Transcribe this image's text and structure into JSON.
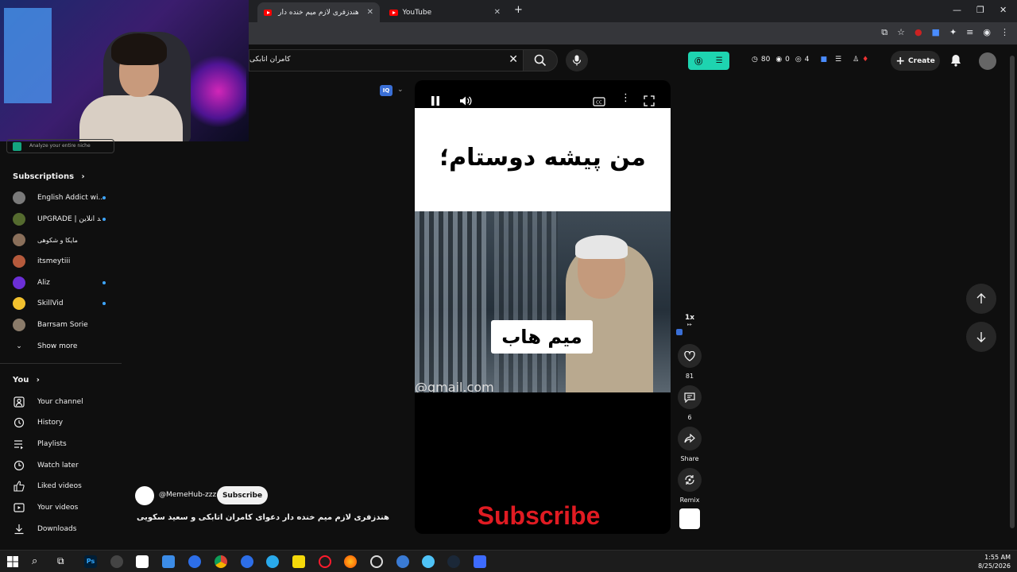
{
  "browser": {
    "tabs": [
      {
        "title": "هندزفری لازم میم خنده دار د...",
        "active": true
      },
      {
        "title": "YouTube",
        "active": false
      }
    ],
    "new_tab": "+",
    "minimize": "—",
    "restore": "❐",
    "close": "✕"
  },
  "header": {
    "search_value": "کامران اتابکی",
    "ext_stats": {
      "views": "80",
      "likes": "0",
      "watch": "4"
    },
    "create_label": "Create"
  },
  "sidebar": {
    "promo_text": "Analyze your entire niche",
    "subscriptions_heading": "Subscriptions",
    "subscriptions": [
      {
        "label": "English Addict wi...",
        "color": "#7a7a7a",
        "dot": true
      },
      {
        "label": "UPGRADE | ارتقا بد آنلاین",
        "color": "#556b2f",
        "dot": true
      },
      {
        "label": "مایکا و شکوهی",
        "color": "#8a6f5a",
        "dot": false
      },
      {
        "label": "itsmeytiii",
        "color": "#b55a3c",
        "dot": false
      },
      {
        "label": "Aliz",
        "color": "#6b2fd6",
        "dot": true
      },
      {
        "label": "SkillVid",
        "color": "#f2c12e",
        "dot": true
      },
      {
        "label": "Barrsam Sorie",
        "color": "#8a7b6a",
        "dot": false
      }
    ],
    "show_more": "Show more",
    "you_heading": "You",
    "you_items": [
      {
        "label": "Your channel",
        "icon": "person-icon"
      },
      {
        "label": "History",
        "icon": "history-icon"
      },
      {
        "label": "Playlists",
        "icon": "playlists-icon"
      },
      {
        "label": "Watch later",
        "icon": "clock-icon"
      },
      {
        "label": "Liked videos",
        "icon": "thumbs-up-icon"
      },
      {
        "label": "Your videos",
        "icon": "video-icon"
      },
      {
        "label": "Downloads",
        "icon": "download-icon"
      }
    ]
  },
  "player": {
    "caption_top": "من پیشه دوستام؛",
    "watermark": "میم هاب",
    "email_fragment": "@gmail.com",
    "subscribe_overlay": "Subscribe",
    "playing": true
  },
  "actions": {
    "speed": "1x",
    "likes": "81",
    "comments": "6",
    "share": "Share",
    "remix": "Remix"
  },
  "channel": {
    "handle": "@MemeHub-zzz",
    "subscribe_label": "Subscribe",
    "video_title": "هندزفری لازم میم خنده دار دعوای کامران اتابکی و سعید سکویی میم ..."
  },
  "taskbar": {
    "time": "1:55 AM",
    "date": "8/25/2026"
  },
  "colors": {
    "accent_blue": "#3ea6ff",
    "subscribe_red": "#e01b22",
    "ext_green": "#1ed4b0"
  }
}
